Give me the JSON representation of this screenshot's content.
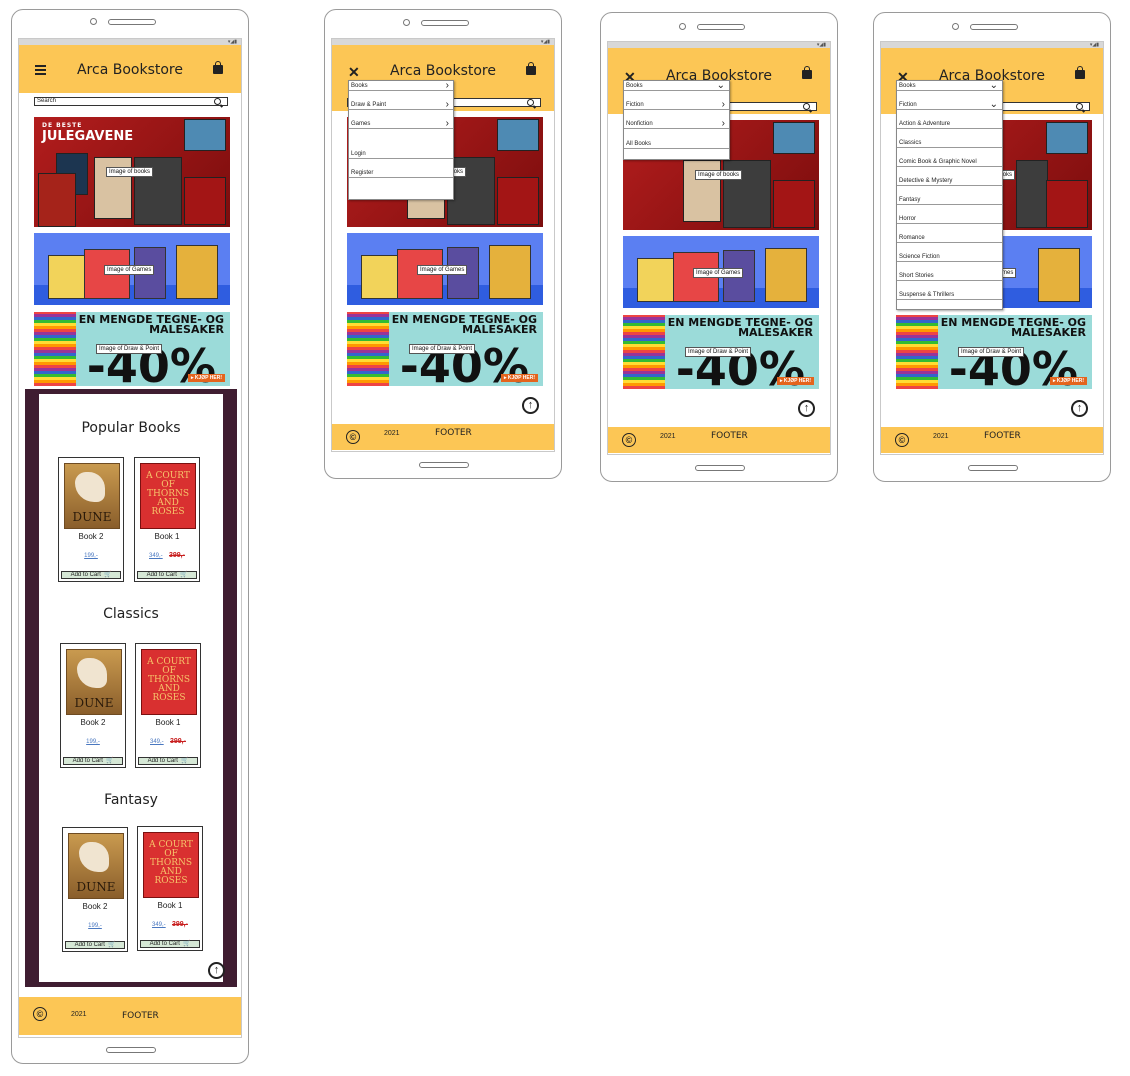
{
  "app": {
    "title": "Arca Bookstore",
    "search_placeholder": "Search",
    "status_text": "▾◢▮",
    "footer_label": "FOOTER",
    "footer_year": "2021",
    "copyright_symbol": "©",
    "up_arrow": "↑"
  },
  "banners": {
    "books": {
      "label": "Image of books",
      "line1": "DE BESTE",
      "line2": "JULEGAVENE"
    },
    "games": {
      "label": "Image of Games"
    },
    "draw": {
      "label": "Image of Draw & Point",
      "headline": "EN MENGDE TEGNE- OG MALESAKER",
      "discount": "-40%",
      "cta": "▸ KJØP HER!"
    }
  },
  "sections": [
    {
      "title": "Popular Books"
    },
    {
      "title": "Classics"
    },
    {
      "title": "Fantasy"
    }
  ],
  "books": [
    {
      "cover_title": "DUNE",
      "name": "Book 2",
      "price": "199,-"
    },
    {
      "cover_title": "A COURT OF THORNS AND ROSES",
      "name": "Book 1",
      "price": "349,-",
      "old_price": "399,-"
    }
  ],
  "add_to_cart": "Add to Cart",
  "cart_icon": "🛒",
  "menu_main": [
    {
      "label": "Books",
      "chevron": "›"
    },
    {
      "label": "Draw & Paint",
      "chevron": "›"
    },
    {
      "label": "Games",
      "chevron": "›"
    },
    {
      "label": "Login",
      "chevron": ""
    },
    {
      "label": "Register",
      "chevron": ""
    }
  ],
  "menu_books": [
    {
      "label": "Books",
      "chevron": "⌄"
    },
    {
      "label": "Fiction",
      "chevron": "›"
    },
    {
      "label": "Nonfiction",
      "chevron": "›"
    },
    {
      "label": "All Books",
      "chevron": ""
    }
  ],
  "menu_fiction": [
    {
      "label": "Books",
      "chevron": "⌄"
    },
    {
      "label": "Fiction",
      "chevron": "⌄"
    },
    {
      "label": "Action & Adventure"
    },
    {
      "label": "Classics"
    },
    {
      "label": "Comic Book & Graphic Novel"
    },
    {
      "label": "Detective & Mystery"
    },
    {
      "label": "Fantasy"
    },
    {
      "label": "Horror"
    },
    {
      "label": "Romance"
    },
    {
      "label": "Science Fiction"
    },
    {
      "label": "Short Stories"
    },
    {
      "label": "Suspense & Thrillers"
    }
  ],
  "colors": {
    "appbar": "#fcc655",
    "sections_bg": "#3f1d31",
    "accent_red": "#c81e1e"
  }
}
